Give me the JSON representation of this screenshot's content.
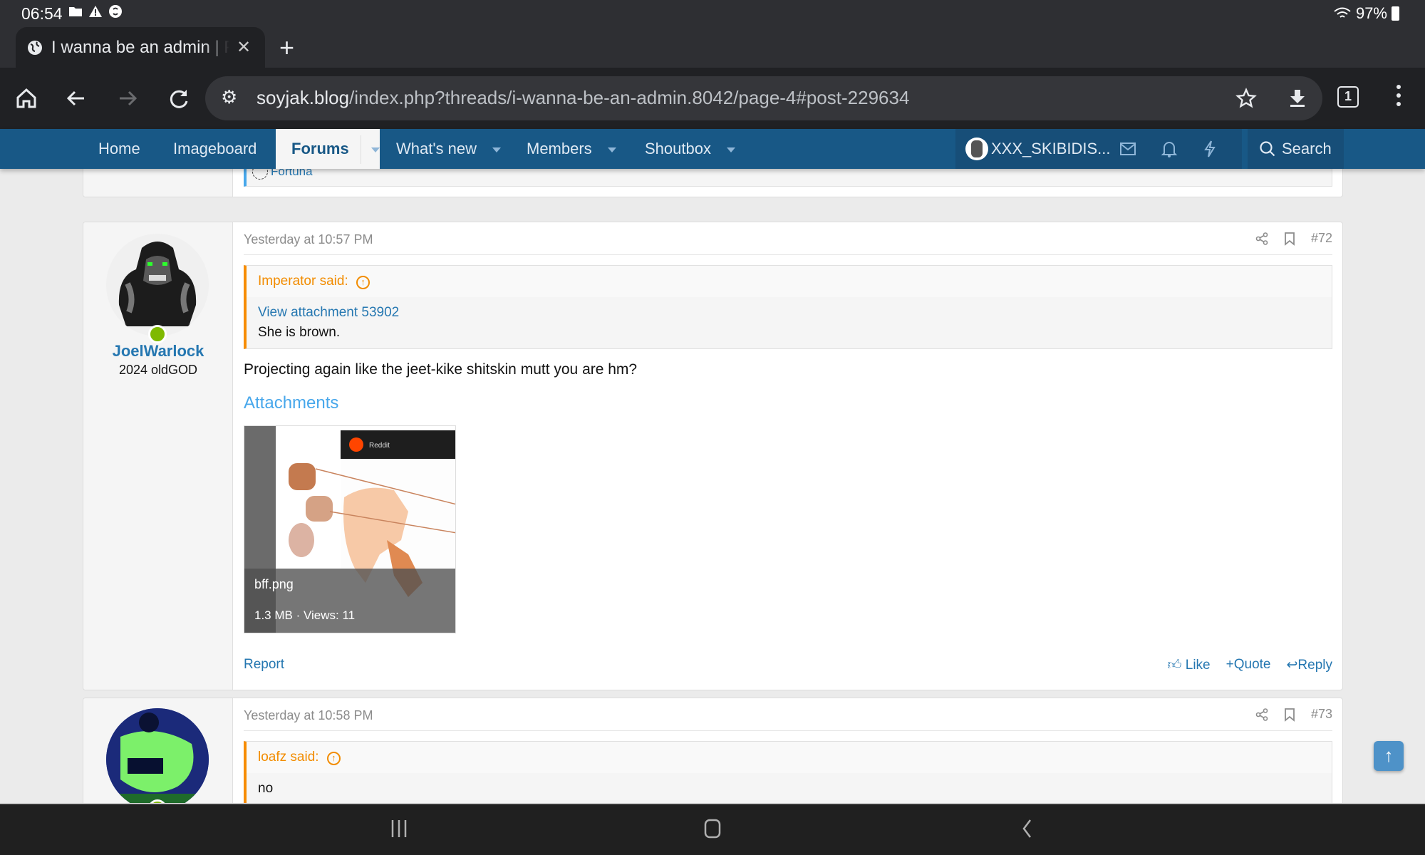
{
  "status_bar": {
    "time": "06:54",
    "battery": "97%",
    "icons": [
      "folder-icon",
      "warning-icon",
      "shazam-icon"
    ],
    "right_icons": [
      "wifi-icon",
      "battery-icon"
    ]
  },
  "browser": {
    "tab_title": "I wanna be an admin | Pa",
    "url_host": "soyjak.blog",
    "url_path": "/index.php?threads/i-wanna-be-an-admin.8042/page-4#post-229634",
    "tab_count": "1"
  },
  "nav": {
    "items": [
      {
        "label": "Home"
      },
      {
        "label": "Imageboard"
      },
      {
        "label": "Forums"
      },
      {
        "label": "What's new"
      },
      {
        "label": "Members"
      },
      {
        "label": "Shoutbox"
      }
    ],
    "username": "XXX_SKIBIDIS...",
    "search_label": "Search"
  },
  "prev_post": {
    "reaction_user": "Fortuna"
  },
  "posts": [
    {
      "date": "Yesterday at 10:57 PM",
      "number": "#72",
      "author": "JoelWarlock",
      "user_title": "2024 oldGOD",
      "quote_author": "Imperator said:",
      "quote_link": "View attachment 53902",
      "quote_text": "She is brown.",
      "body": "Projecting again like the jeet-kike shitskin mutt you are hm?",
      "attachments_label": "Attachments",
      "attachment": {
        "filename": "bff.png",
        "meta": "1.3 MB · Views: 11",
        "thumb_header": "Reddit"
      },
      "report_label": "Report",
      "actions": {
        "like": "Like",
        "quote": "Quote",
        "reply": "Reply"
      }
    },
    {
      "date": "Yesterday at 10:58 PM",
      "number": "#73",
      "quote_author": "loafz said:",
      "quote_text": "no"
    }
  ],
  "colors": {
    "nav_bg": "#185886",
    "link": "#2577b1",
    "quote_accent": "#f78c00",
    "online": "#7fb900"
  }
}
